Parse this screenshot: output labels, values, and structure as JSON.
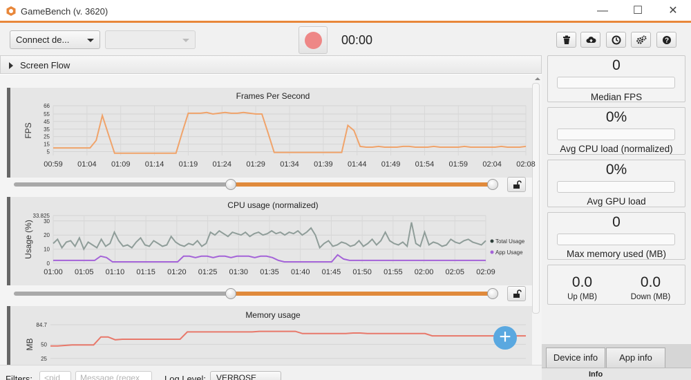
{
  "window": {
    "title": "GameBench (v. 3620)",
    "controls": {
      "minimize": "—",
      "maximize": "☐",
      "close": "✕"
    }
  },
  "toolbar": {
    "device_combo_label": "Connect de...",
    "app_combo_label": "",
    "timer": "00:00",
    "icons": [
      "trash-icon",
      "cloud-upload-icon",
      "clock-icon",
      "gears-icon",
      "help-icon"
    ]
  },
  "screen_flow": {
    "label": "Screen Flow"
  },
  "colors": {
    "accent": "#e8873a",
    "fps_line": "#f0a36a",
    "cpu_total": "#8f9d99",
    "cpu_app": "#a463d8",
    "memory_line": "#e8786a",
    "record": "#ee8786",
    "plus": "#5aa8e0"
  },
  "chart_data": [
    {
      "type": "line",
      "title": "Frames Per Second",
      "ylabel": "FPS",
      "xlabel": "",
      "yticks": [
        "66",
        "55",
        "45",
        "35",
        "25",
        "15",
        "5"
      ],
      "ylim": [
        0,
        66
      ],
      "xticks": [
        "00:59",
        "01:04",
        "01:09",
        "01:14",
        "01:19",
        "01:24",
        "01:29",
        "01:34",
        "01:39",
        "01:44",
        "01:49",
        "01:54",
        "01:59",
        "02:04",
        "02:08"
      ],
      "series": [
        {
          "values": [
            10,
            10,
            10,
            10,
            10,
            10,
            10,
            20,
            53,
            28,
            3,
            3,
            3,
            3,
            3,
            3,
            3,
            3,
            3,
            3,
            3,
            30,
            56,
            56,
            56,
            57,
            55,
            56,
            57,
            56,
            56,
            57,
            56,
            55,
            55,
            30,
            4,
            4,
            4,
            4,
            4,
            4,
            4,
            4,
            4,
            4,
            4,
            4,
            40,
            33,
            12,
            11,
            11,
            12,
            11,
            11,
            11,
            12,
            12,
            11,
            11,
            11,
            12,
            11,
            11,
            11,
            11,
            12,
            11,
            11,
            11,
            11,
            11,
            12,
            11,
            11,
            11,
            12
          ]
        }
      ]
    },
    {
      "type": "line",
      "title": "CPU usage (normalized)",
      "ylabel": "Usage (%)",
      "xlabel": "",
      "yticks": [
        "33.825",
        "30",
        "20",
        "10",
        "0"
      ],
      "ylim": [
        0,
        33.825
      ],
      "xticks": [
        "01:00",
        "01:05",
        "01:10",
        "01:15",
        "01:20",
        "01:25",
        "01:30",
        "01:35",
        "01:40",
        "01:45",
        "01:50",
        "01:55",
        "02:00",
        "02:05",
        "02:09"
      ],
      "series": [
        {
          "name": "Total Usage",
          "values": [
            14,
            17,
            11,
            15,
            16,
            12,
            18,
            10,
            15,
            13,
            11,
            17,
            12,
            14,
            22,
            16,
            12,
            13,
            11,
            15,
            18,
            13,
            12,
            16,
            14,
            12,
            13,
            19,
            15,
            13,
            12,
            14,
            13,
            16,
            12,
            14,
            22,
            20,
            23,
            21,
            19,
            22,
            21,
            20,
            22,
            19,
            21,
            22,
            20,
            21,
            23,
            21,
            22,
            20,
            22,
            21,
            23,
            20,
            22,
            25,
            20,
            11,
            14,
            16,
            12,
            13,
            15,
            14,
            12,
            13,
            16,
            12,
            14,
            17,
            13,
            16,
            22,
            16,
            14,
            13,
            15,
            12,
            29,
            14,
            12,
            22,
            13,
            15,
            14,
            12,
            13,
            17,
            15,
            14,
            16,
            17,
            15,
            14,
            13,
            16
          ]
        },
        {
          "name": "App Usage",
          "values": [
            2,
            2,
            2,
            2,
            2,
            2,
            2,
            2,
            5,
            4,
            1,
            1,
            1,
            1,
            1,
            1,
            1,
            1,
            1,
            1,
            1,
            1,
            5,
            5,
            4,
            5,
            5,
            4,
            5,
            5,
            4,
            5,
            5,
            5,
            4,
            5,
            5,
            4,
            2,
            1,
            1,
            1,
            1,
            1,
            1,
            1,
            1,
            1,
            6,
            3,
            2,
            2,
            2,
            2,
            2,
            2,
            2,
            2,
            2,
            2,
            2,
            2,
            2,
            2,
            2,
            2,
            2,
            2,
            2,
            2,
            2,
            2,
            2,
            2
          ]
        }
      ],
      "legend_position": "right"
    },
    {
      "type": "line",
      "title": "Memory usage",
      "ylabel": "MB",
      "xlabel": "",
      "yticks": [
        "84.7",
        "50",
        "25"
      ],
      "ylim": [
        15,
        84.7
      ],
      "series": [
        {
          "values": [
            47,
            47,
            48,
            49,
            49,
            49,
            49,
            63,
            63,
            58,
            59,
            59,
            59,
            59,
            59,
            59,
            59,
            59,
            59,
            72,
            72,
            72,
            72,
            72,
            72,
            72,
            72,
            72,
            72,
            73,
            73,
            73,
            73,
            73,
            73,
            69,
            69,
            69,
            69,
            69,
            69,
            69,
            70,
            70,
            69,
            69,
            69,
            69,
            69,
            69,
            69,
            69,
            69,
            65,
            65,
            65,
            65,
            65,
            65,
            65,
            65,
            65,
            65,
            65,
            65,
            65,
            65
          ]
        }
      ]
    }
  ],
  "charts": {
    "fps": {
      "title": "Frames Per Second",
      "ylabel": "FPS"
    },
    "cpu": {
      "title": "CPU usage (normalized)",
      "ylabel": "Usage (%)",
      "legend_total": "Total Usage",
      "legend_app": "App Usage"
    },
    "memory": {
      "title": "Memory usage",
      "ylabel": "MB"
    },
    "range": {
      "start_fraction": 0.45,
      "end_fraction": 1.0
    }
  },
  "filters": {
    "label": "Filters:",
    "pid_placeholder": "<pid",
    "message_placeholder": "Message (regex",
    "log_level_label": "Log Level:",
    "log_level_value": "VERBOSE"
  },
  "stats": {
    "median_fps": {
      "value": "0",
      "label": "Median FPS"
    },
    "avg_cpu": {
      "value": "0%",
      "label": "Avg CPU load (normalized)"
    },
    "avg_gpu": {
      "value": "0%",
      "label": "Avg GPU load"
    },
    "max_memory": {
      "value": "0",
      "label": "Max memory used (MB)"
    },
    "network": {
      "up_value": "0.0",
      "up_label": "Up (MB)",
      "down_value": "0.0",
      "down_label": "Down (MB)"
    }
  },
  "tabs": {
    "device_info": "Device info",
    "app_info": "App info",
    "info": "Info"
  }
}
